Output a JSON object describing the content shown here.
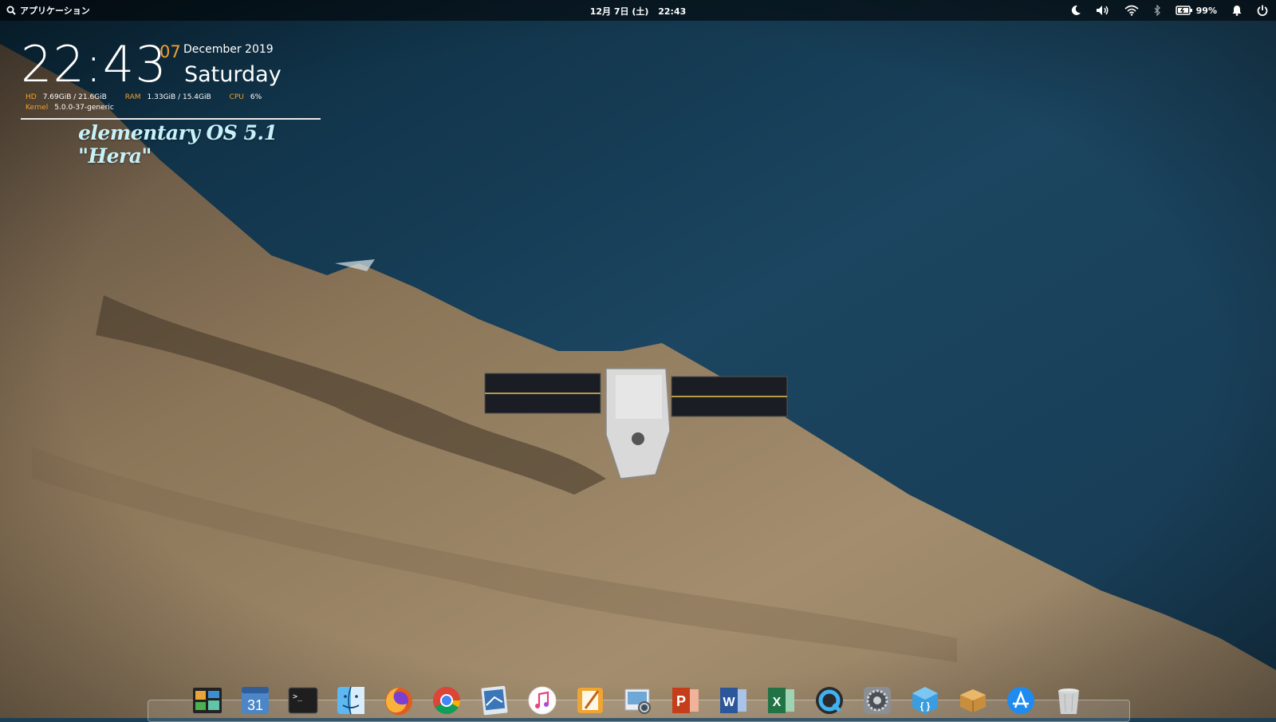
{
  "panel": {
    "applications_label": "アプリケーション",
    "date": "12月 7日 (土)",
    "time": "22:43",
    "battery_percent": "99%"
  },
  "conky": {
    "time": "22:43",
    "day": "07",
    "month_year": "December 2019",
    "weekday": "Saturday",
    "hd_label": "HD",
    "hd_value": "7.69GiB / 21.6GiB",
    "ram_label": "RAM",
    "ram_value": "1.33GiB / 15.4GiB",
    "cpu_label": "CPU",
    "cpu_value": "6%",
    "kernel_label": "Kernel",
    "kernel_value": "5.0.0-37-generic",
    "os_name": "elementary OS 5.1 \"Hera\""
  },
  "dock": {
    "items": [
      {
        "icon": "multitasking-view-icon"
      },
      {
        "icon": "calendar-icon",
        "label": "31"
      },
      {
        "icon": "terminal-icon",
        "label": ">_"
      },
      {
        "icon": "finder-icon"
      },
      {
        "icon": "firefox-icon"
      },
      {
        "icon": "chrome-icon"
      },
      {
        "icon": "photo-editor-icon"
      },
      {
        "icon": "itunes-icon"
      },
      {
        "icon": "pages-icon"
      },
      {
        "icon": "preview-icon"
      },
      {
        "icon": "powerpoint-icon",
        "label": "P"
      },
      {
        "icon": "word-icon",
        "label": "W"
      },
      {
        "icon": "excel-icon",
        "label": "X"
      },
      {
        "icon": "quicktime-icon"
      },
      {
        "icon": "system-settings-icon"
      },
      {
        "icon": "code-editor-icon"
      },
      {
        "icon": "package-installer-icon"
      },
      {
        "icon": "app-store-icon"
      },
      {
        "icon": "trash-icon"
      }
    ]
  },
  "colors": {
    "accent_orange": "#f0a030",
    "os_name_cyan": "#c7f2fa",
    "ocean": "#1c3f56",
    "land": "#9a8466"
  }
}
